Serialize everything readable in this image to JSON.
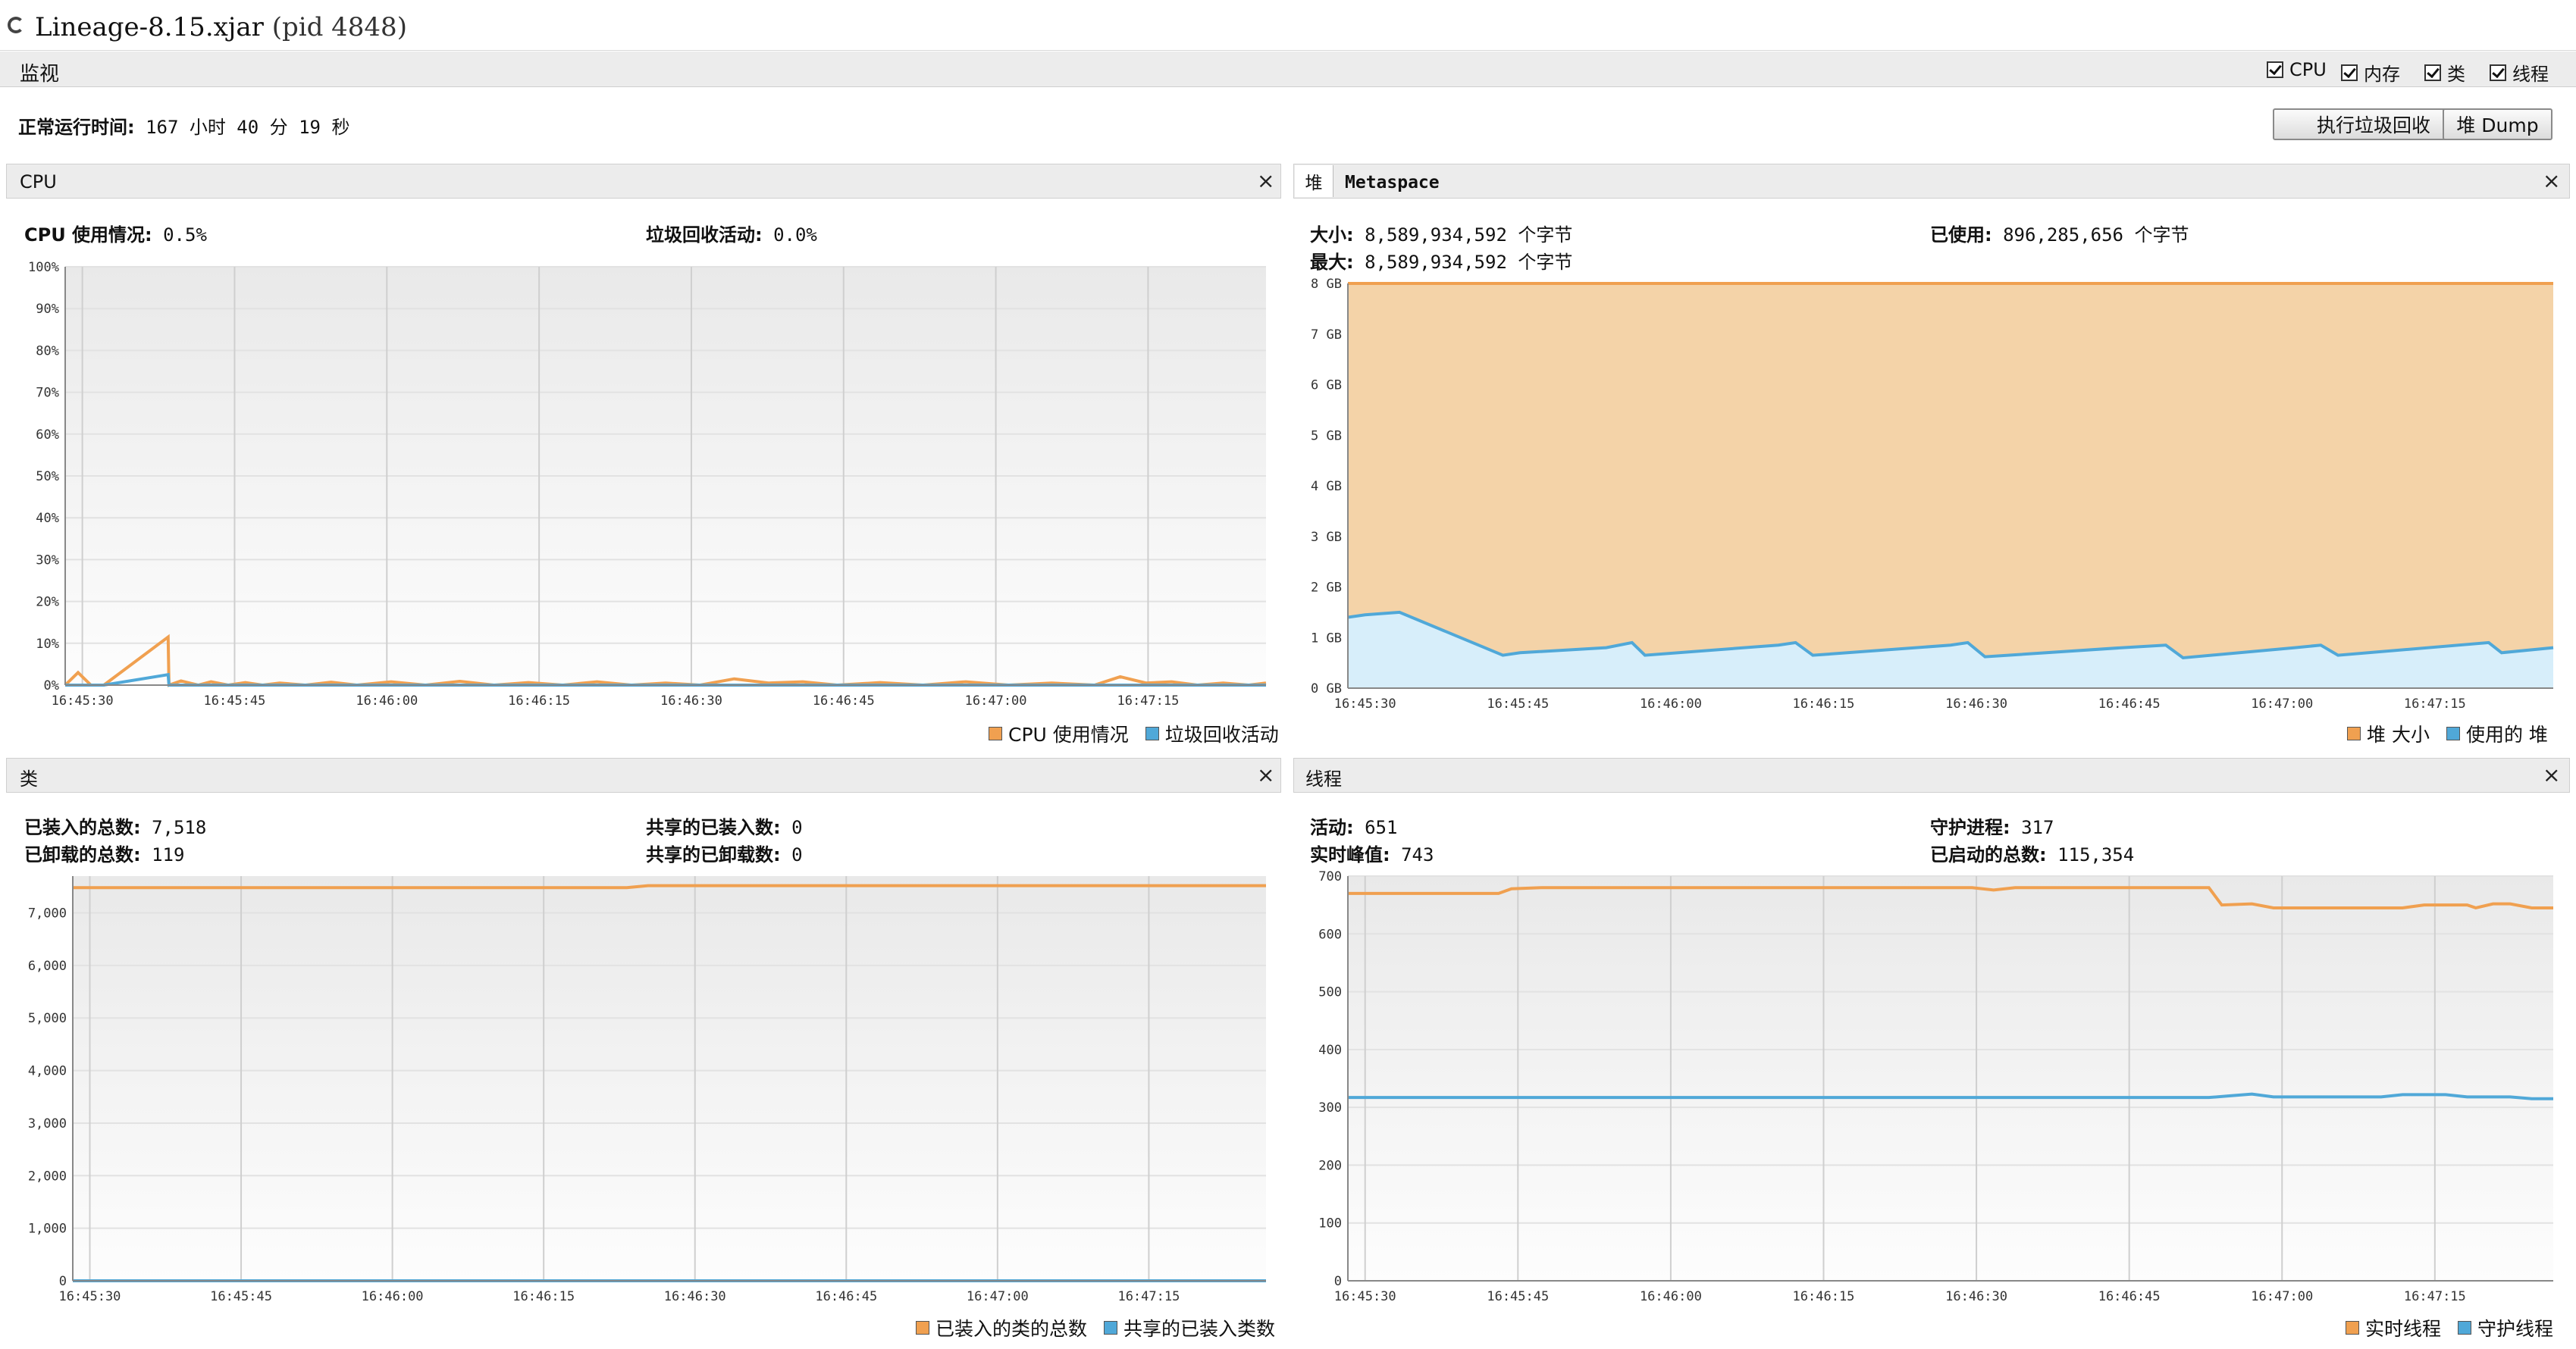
{
  "window": {
    "title": "Lineage-8.15.xjar",
    "pid": "(pid 4848)"
  },
  "monitor": {
    "label": "监视",
    "checkboxes": [
      {
        "label": "CPU",
        "checked": true
      },
      {
        "label": "内存",
        "checked": true
      },
      {
        "label": "类",
        "checked": true
      },
      {
        "label": "线程",
        "checked": true
      }
    ]
  },
  "uptime": {
    "label": "正常运行时间:",
    "value": "167 小时 40 分 19 秒"
  },
  "buttons": {
    "gc": "执行垃圾回收",
    "heap_dump": "堆 Dump"
  },
  "colors": {
    "orange": "#f0a050",
    "blue": "#50a8d8",
    "orange_fill": "#f2c58e",
    "blue_fill": "#cfe9f7"
  },
  "cpu_panel": {
    "title": "CPU",
    "usage_label": "CPU 使用情况:",
    "usage_value": "0.5%",
    "gc_label": "垃圾回收活动:",
    "gc_value": "0.0%",
    "legend": [
      "CPU 使用情况",
      "垃圾回收活动"
    ],
    "y_ticks": [
      "100%",
      "90%",
      "80%",
      "70%",
      "60%",
      "50%",
      "40%",
      "30%",
      "20%",
      "10%",
      "0%"
    ],
    "x_ticks": [
      "16:45:30",
      "16:45:45",
      "16:46:00",
      "16:46:15",
      "16:46:30",
      "16:46:45",
      "16:47:00",
      "16:47:15"
    ]
  },
  "heap_panel": {
    "tabs": [
      "堆",
      "Metaspace"
    ],
    "size_label": "大小:",
    "size_value": "8,589,934,592 个字节",
    "used_label": "已使用:",
    "used_value": "896,285,656 个字节",
    "max_label": "最大:",
    "max_value": "8,589,934,592 个字节",
    "legend": [
      "堆 大小",
      "使用的 堆"
    ],
    "y_ticks": [
      "8 GB",
      "7 GB",
      "6 GB",
      "5 GB",
      "4 GB",
      "3 GB",
      "2 GB",
      "1 GB",
      "0 GB"
    ],
    "x_ticks": [
      "16:45:30",
      "16:45:45",
      "16:46:00",
      "16:46:15",
      "16:46:30",
      "16:46:45",
      "16:47:00",
      "16:47:15"
    ]
  },
  "classes_panel": {
    "title": "类",
    "loaded_label": "已装入的总数:",
    "loaded_value": "7,518",
    "unloaded_label": "已卸载的总数:",
    "unloaded_value": "119",
    "shared_loaded_label": "共享的已装入数:",
    "shared_loaded_value": "0",
    "shared_unloaded_label": "共享的已卸载数:",
    "shared_unloaded_value": "0",
    "legend": [
      "已装入的类的总数",
      "共享的已装入类数"
    ],
    "y_ticks": [
      "7,000",
      "6,000",
      "5,000",
      "4,000",
      "3,000",
      "2,000",
      "1,000",
      "0"
    ],
    "x_ticks": [
      "16:45:30",
      "16:45:45",
      "16:46:00",
      "16:46:15",
      "16:46:30",
      "16:46:45",
      "16:47:00",
      "16:47:15"
    ]
  },
  "threads_panel": {
    "title": "线程",
    "live_label": "活动:",
    "live_value": "651",
    "peak_label": "实时峰值:",
    "peak_value": "743",
    "daemon_label": "守护进程:",
    "daemon_value": "317",
    "started_label": "已启动的总数:",
    "started_value": "115,354",
    "legend": [
      "实时线程",
      "守护线程"
    ],
    "y_ticks": [
      "700",
      "600",
      "500",
      "400",
      "300",
      "200",
      "100",
      "0"
    ],
    "x_ticks": [
      "16:45:30",
      "16:45:45",
      "16:46:00",
      "16:46:15",
      "16:46:30",
      "16:46:45",
      "16:47:00",
      "16:47:15"
    ]
  },
  "chart_data": [
    {
      "type": "line",
      "title": "CPU",
      "ylim": [
        0,
        100
      ],
      "yunit": "%",
      "series": [
        {
          "name": "CPU 使用情况",
          "points": [
            [
              0,
              0
            ],
            [
              3,
              3
            ],
            [
              6,
              0
            ],
            [
              9,
              0
            ],
            [
              24,
              11.5
            ],
            [
              24.2,
              0
            ],
            [
              27,
              1
            ],
            [
              31,
              0
            ],
            [
              34,
              0.8
            ],
            [
              38,
              0
            ],
            [
              42,
              0.6
            ],
            [
              46,
              0
            ],
            [
              50,
              0.5
            ],
            [
              56,
              0
            ],
            [
              62,
              0.7
            ],
            [
              68,
              0
            ],
            [
              76,
              0.8
            ],
            [
              84,
              0
            ],
            [
              92,
              0.9
            ],
            [
              100,
              0
            ],
            [
              108,
              0.6
            ],
            [
              116,
              0
            ],
            [
              124,
              0.8
            ],
            [
              132,
              0
            ],
            [
              140,
              0.5
            ],
            [
              148,
              0
            ],
            [
              156,
              1.5
            ],
            [
              164,
              0.5
            ],
            [
              172,
              0.8
            ],
            [
              180,
              0
            ],
            [
              190,
              0.6
            ],
            [
              200,
              0
            ],
            [
              210,
              0.8
            ],
            [
              220,
              0
            ],
            [
              230,
              0.5
            ],
            [
              240,
              0
            ],
            [
              246,
              2
            ],
            [
              252,
              0.5
            ],
            [
              258,
              0.8
            ],
            [
              264,
              0
            ],
            [
              270,
              0.5
            ],
            [
              276,
              0
            ],
            [
              280,
              0.5
            ]
          ]
        },
        {
          "name": "垃圾回收活动",
          "points": [
            [
              0,
              0
            ],
            [
              9,
              0
            ],
            [
              24,
              2.5
            ],
            [
              24.2,
              0
            ],
            [
              280,
              0
            ]
          ]
        }
      ]
    },
    {
      "type": "area",
      "title": "堆",
      "ylim": [
        0,
        8
      ],
      "yunit": "GB",
      "series": [
        {
          "name": "堆 大小",
          "points": [
            [
              0,
              8
            ],
            [
              280,
              8
            ]
          ]
        },
        {
          "name": "使用的 堆",
          "points": [
            [
              0,
              1.4
            ],
            [
              4,
              1.45
            ],
            [
              12,
              1.5
            ],
            [
              36,
              0.65
            ],
            [
              40,
              0.7
            ],
            [
              60,
              0.8
            ],
            [
              66,
              0.9
            ],
            [
              69,
              0.65
            ],
            [
              100,
              0.85
            ],
            [
              104,
              0.9
            ],
            [
              108,
              0.65
            ],
            [
              140,
              0.85
            ],
            [
              144,
              0.9
            ],
            [
              148,
              0.62
            ],
            [
              180,
              0.8
            ],
            [
              190,
              0.85
            ],
            [
              194,
              0.6
            ],
            [
              220,
              0.8
            ],
            [
              226,
              0.85
            ],
            [
              230,
              0.65
            ],
            [
              265,
              0.9
            ],
            [
              268,
              0.7
            ],
            [
              280,
              0.8
            ]
          ]
        }
      ]
    },
    {
      "type": "line",
      "title": "类",
      "ylim": [
        0,
        7700
      ],
      "series": [
        {
          "name": "已装入的类的总数",
          "points": [
            [
              0,
              7480
            ],
            [
              130,
              7480
            ],
            [
              135,
              7518
            ],
            [
              280,
              7518
            ]
          ]
        },
        {
          "name": "共享的已装入类数",
          "points": [
            [
              0,
              0
            ],
            [
              280,
              0
            ]
          ]
        }
      ]
    },
    {
      "type": "line",
      "title": "线程",
      "ylim": [
        0,
        700
      ],
      "series": [
        {
          "name": "实时线程",
          "points": [
            [
              0,
              670
            ],
            [
              35,
              670
            ],
            [
              38,
              678
            ],
            [
              45,
              680
            ],
            [
              145,
              680
            ],
            [
              150,
              676
            ],
            [
              155,
              680
            ],
            [
              200,
              680
            ],
            [
              203,
              650
            ],
            [
              210,
              652
            ],
            [
              215,
              645
            ],
            [
              245,
              645
            ],
            [
              250,
              650
            ],
            [
              260,
              650
            ],
            [
              262,
              645
            ],
            [
              266,
              652
            ],
            [
              270,
              652
            ],
            [
              275,
              645
            ],
            [
              280,
              645
            ]
          ]
        },
        {
          "name": "守护线程",
          "points": [
            [
              0,
              317
            ],
            [
              200,
              317
            ],
            [
              205,
              320
            ],
            [
              210,
              323
            ],
            [
              215,
              318
            ],
            [
              228,
              318
            ],
            [
              240,
              318
            ],
            [
              245,
              322
            ],
            [
              255,
              322
            ],
            [
              260,
              318
            ],
            [
              270,
              318
            ],
            [
              275,
              315
            ],
            [
              280,
              315
            ]
          ]
        }
      ]
    }
  ]
}
